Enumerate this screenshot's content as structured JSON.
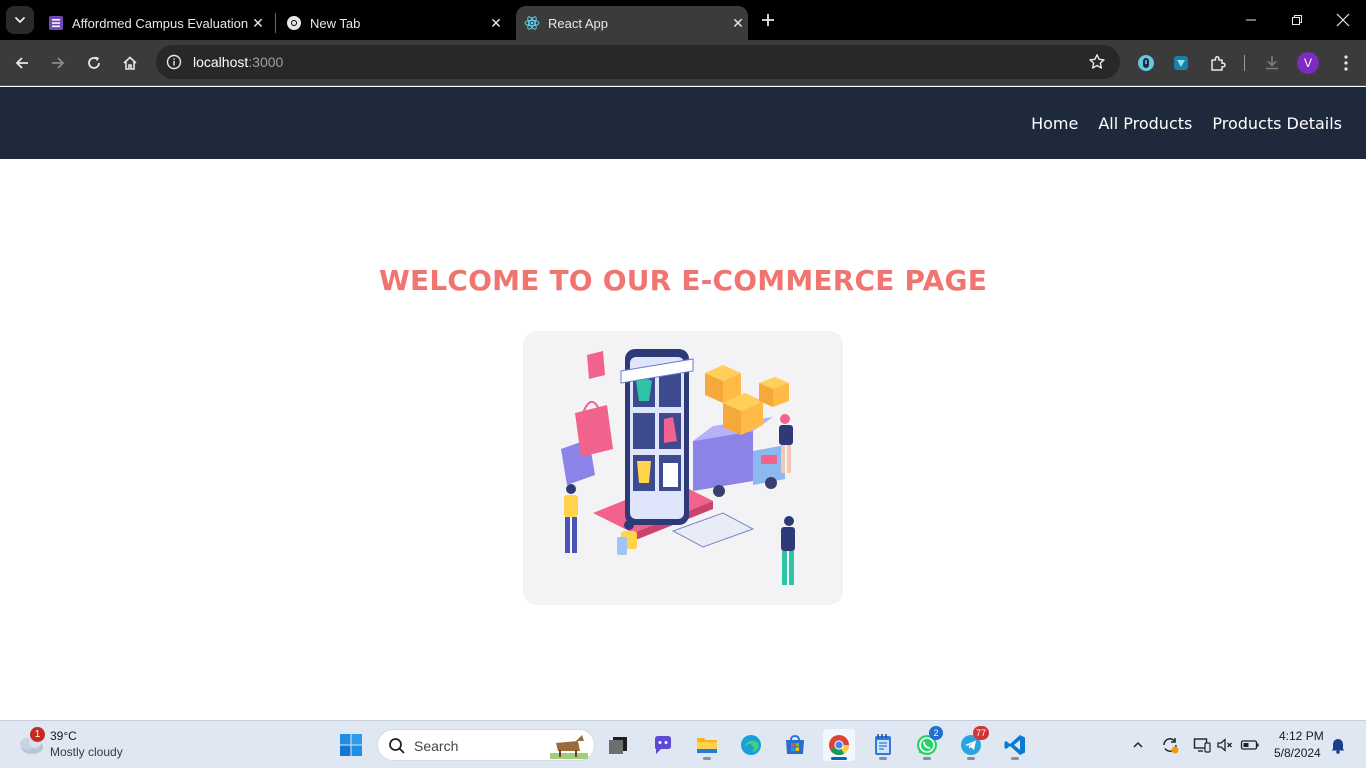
{
  "browser": {
    "tabs": [
      {
        "title": "Affordmed Campus Evaluation",
        "icon": "forms-icon",
        "active": false
      },
      {
        "title": "New Tab",
        "icon": "chrome-icon",
        "active": false
      },
      {
        "title": "React App",
        "icon": "react-icon",
        "active": true
      }
    ],
    "address": {
      "host": "localhost",
      "port": ":3000"
    },
    "profile_initial": "V",
    "colors": {
      "tabstrip": "#000000",
      "toolbar": "#3b3b3b",
      "omnibox": "#282828",
      "profile": "#7d2bc0"
    }
  },
  "page": {
    "nav": {
      "links": [
        "Home",
        "All Products",
        "Products Details"
      ],
      "background": "#1e293b"
    },
    "welcome_title": "WELCOME TO OUR E-COMMERCE PAGE",
    "title_color": "#f07470",
    "hero_image_alt": "isometric e-commerce illustration"
  },
  "taskbar": {
    "weather": {
      "temp": "39°C",
      "desc": "Mostly cloudy",
      "badge": "1"
    },
    "search_label": "Search",
    "apps": [
      {
        "name": "start-button",
        "icon": "windows-icon"
      },
      {
        "name": "task-view",
        "icon": "task-view-icon"
      },
      {
        "name": "copilot",
        "icon": "copilot-icon"
      },
      {
        "name": "file-explorer",
        "icon": "folder-icon"
      },
      {
        "name": "edge",
        "icon": "edge-icon"
      },
      {
        "name": "store",
        "icon": "store-icon"
      },
      {
        "name": "chrome",
        "icon": "chrome-icon",
        "active": true
      },
      {
        "name": "notepad",
        "icon": "notepad-icon"
      },
      {
        "name": "whatsapp",
        "icon": "whatsapp-icon",
        "badge": "2"
      },
      {
        "name": "telegram",
        "icon": "telegram-icon",
        "badge": "77"
      },
      {
        "name": "vscode",
        "icon": "vscode-icon"
      }
    ],
    "clock": {
      "time": "4:12 PM",
      "date": "5/8/2024"
    }
  }
}
